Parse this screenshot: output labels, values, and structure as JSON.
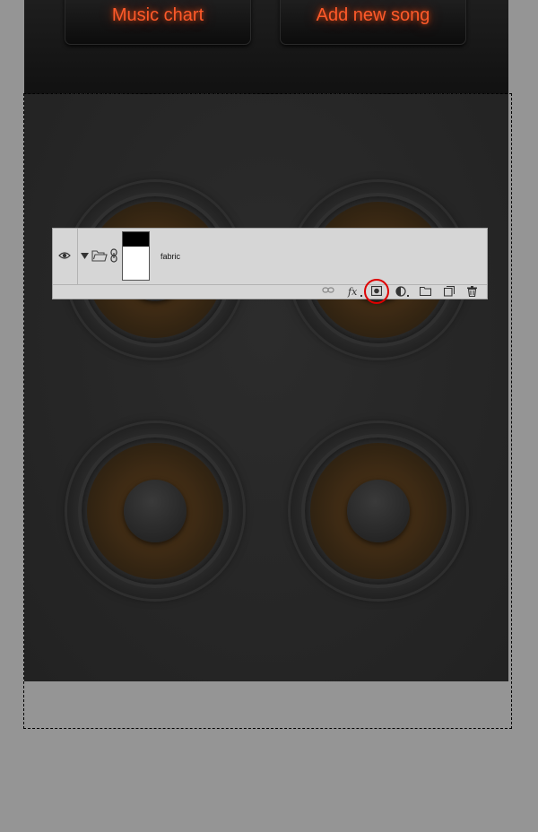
{
  "canvas": {
    "buttons": {
      "music_chart": "Music chart",
      "add_new_song": "Add new song"
    },
    "speaker_cone_color": "#3d2a14",
    "cabinet_color": "#282828",
    "button_text_color": "#ff5a2a"
  },
  "layers_panel": {
    "layer": {
      "name": "fabric",
      "visible": true,
      "expanded": true,
      "type": "group",
      "has_mask": true
    },
    "toolbar_icons": [
      "link-layers-icon",
      "layer-style-fx-icon",
      "add-layer-mask-icon",
      "adjustment-layer-icon",
      "new-group-icon",
      "new-layer-icon",
      "delete-layer-icon"
    ],
    "highlighted_tool": "add-layer-mask-icon",
    "highlight_color": "#dd0000"
  }
}
